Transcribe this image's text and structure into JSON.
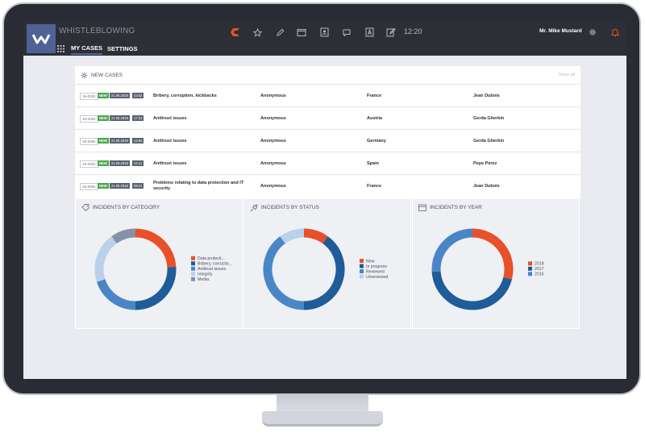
{
  "app": {
    "title": "WHISTLEBLOWING",
    "clock": "12:20",
    "user": "Mr. Mike Mustard"
  },
  "nav": {
    "tabs": [
      {
        "label": "MY CASES"
      },
      {
        "label": "SETTINGS"
      }
    ]
  },
  "colors": {
    "accent": "#4f6296",
    "orange": "#e8502a",
    "darkblue": "#1f5c99",
    "midblue": "#4a86c5",
    "lightblue": "#b9d1ea",
    "gray": "#8591a8",
    "green": "#4ca64c"
  },
  "new_cases": {
    "title": "NEW CASES",
    "show_all": "Show all",
    "rows": [
      {
        "id": "18-0091",
        "badge": "NEW",
        "date": "21.05.2018",
        "time": "23:52",
        "subject": "Bribery, corruption, kickbacks",
        "reporter": "Anonymous",
        "country": "France",
        "handler": "Jean Dubois"
      },
      {
        "id": "18-0091",
        "badge": "NEW",
        "date": "21.05.2018",
        "time": "17:34",
        "subject": "Antitrust issues",
        "reporter": "Anonymous",
        "country": "Austria",
        "handler": "Gerda Gherkin"
      },
      {
        "id": "18-0091",
        "badge": "NEW",
        "date": "21.05.2018",
        "time": "14:55",
        "subject": "Antitrust issues",
        "reporter": "Anonymous",
        "country": "Germany",
        "handler": "Gerda Gherkin"
      },
      {
        "id": "18-0091",
        "badge": "NEW",
        "date": "21.05.2018",
        "time": "12:11",
        "subject": "Antitrust issues",
        "reporter": "Anonymous",
        "country": "Spain",
        "handler": "Pepe Pérez"
      },
      {
        "id": "18-0091",
        "badge": "NEW",
        "date": "21.05.2018",
        "time": "08:11",
        "subject": "Problems relating to data protection and IT security",
        "reporter": "Anonymous",
        "country": "France",
        "handler": "Jean Dubois"
      }
    ]
  },
  "chart_data": [
    {
      "type": "pie",
      "title": "INCIDENTS BY CATEGORY",
      "categories": [
        "Data protecti...",
        "Bribery, corructio...",
        "Antitrust issues",
        "Integrity",
        "Media"
      ],
      "values": [
        24,
        26,
        20,
        20,
        10
      ],
      "colors": [
        "#e8502a",
        "#1f5c99",
        "#4a86c5",
        "#b9d1ea",
        "#8591a8"
      ]
    },
    {
      "type": "pie",
      "title": "INCIDENTS BY STATUS",
      "categories": [
        "New",
        "In progress",
        "Reviewed",
        "Unreviewed"
      ],
      "values": [
        10,
        40,
        40,
        10
      ],
      "colors": [
        "#e8502a",
        "#1f5c99",
        "#4a86c5",
        "#b9d1ea"
      ]
    },
    {
      "type": "pie",
      "title": "INCIDENTS BY YEAR",
      "categories": [
        "2018",
        "2017",
        "2016"
      ],
      "values": [
        29,
        45,
        26
      ],
      "colors": [
        "#e8502a",
        "#1f5c99",
        "#4a86c5"
      ]
    }
  ]
}
